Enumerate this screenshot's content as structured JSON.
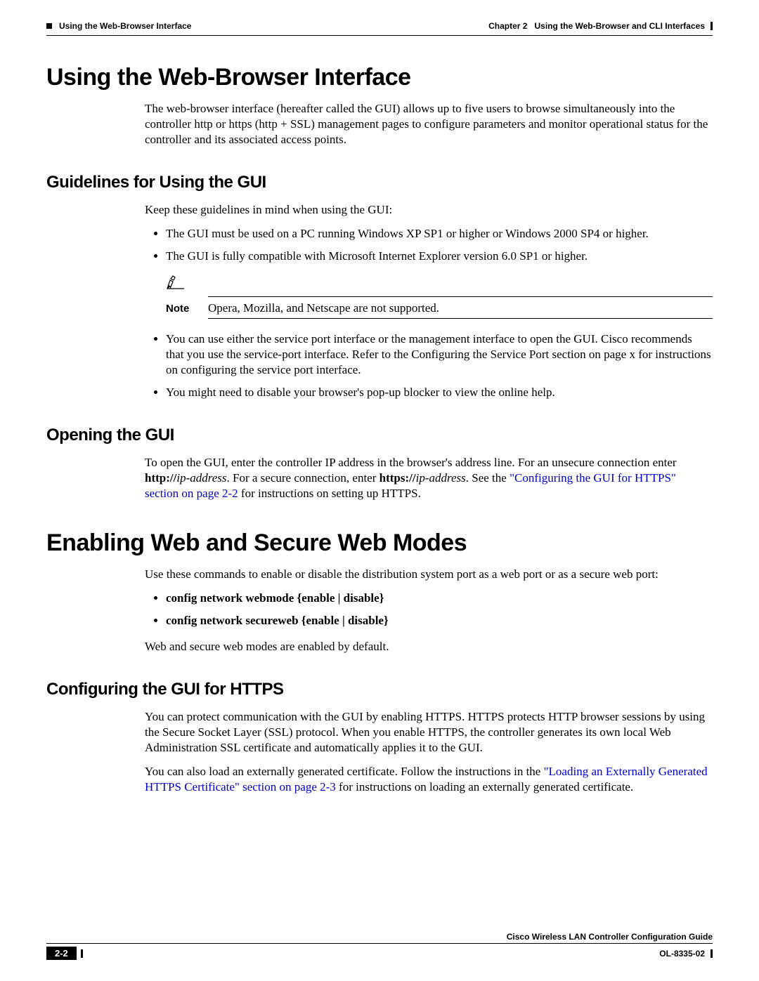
{
  "header": {
    "section_title": "Using the Web-Browser Interface",
    "chapter_label": "Chapter 2",
    "chapter_title": "Using the Web-Browser and CLI Interfaces"
  },
  "h1_1": "Using the Web-Browser Interface",
  "intro_p": "The web-browser interface (hereafter called the GUI) allows up to five users to browse simultaneously into the controller http or https (http + SSL) management pages to configure parameters and monitor operational status for the controller and its associated access points.",
  "h2_guidelines": "Guidelines for Using the GUI",
  "guidelines_intro": "Keep these guidelines in mind when using the GUI:",
  "guideline_1": "The GUI must be used on a PC running Windows XP SP1 or higher or Windows 2000 SP4 or higher.",
  "guideline_2": "The GUI is fully compatible with Microsoft Internet Explorer version 6.0 SP1 or higher.",
  "note_label": "Note",
  "note_text": "Opera, Mozilla, and Netscape are not supported.",
  "guideline_3": "You can use either the service port interface or the management interface to open the GUI. Cisco recommends that you use the service-port interface. Refer to the Configuring the Service Port section on page x for instructions on configuring the service port interface.",
  "guideline_4": "You might need to disable your browser's pop-up blocker to view the online help.",
  "h2_opening": "Opening the GUI",
  "opening_p_pre": "To open the GUI, enter the controller IP address in the browser's address line. For an unsecure connection enter ",
  "opening_http": "http://",
  "opening_ip": "ip-address",
  "opening_mid": ". For a secure connection, enter ",
  "opening_https": "https://",
  "opening_post": ". See the ",
  "opening_link": "\"Configuring the GUI for HTTPS\" section on page 2-2",
  "opening_end": " for instructions on setting up HTTPS.",
  "h1_2": "Enabling Web and Secure Web Modes",
  "enabling_intro": "Use these commands to enable or disable the distribution system port as a web port or as a secure web port:",
  "cmd_1": "config network webmode {enable | disable}",
  "cmd_2": "config network secureweb {enable | disable}",
  "enabling_end": "Web and secure web modes are enabled by default.",
  "h2_https": "Configuring the GUI for HTTPS",
  "https_p1": "You can protect communication with the GUI by enabling HTTPS. HTTPS protects HTTP browser sessions by using the Secure Socket Layer (SSL) protocol. When you enable HTTPS, the controller generates its own local Web Administration SSL certificate and automatically applies it to the GUI.",
  "https_p2_pre": "You can also load an externally generated certificate. Follow the instructions in the ",
  "https_p2_link": "\"Loading an Externally Generated HTTPS Certificate\" section on page 2-3",
  "https_p2_post": " for instructions on loading an externally generated certificate.",
  "footer": {
    "guide_title": "Cisco Wireless LAN Controller Configuration Guide",
    "page_num": "2-2",
    "doc_id": "OL-8335-02"
  }
}
